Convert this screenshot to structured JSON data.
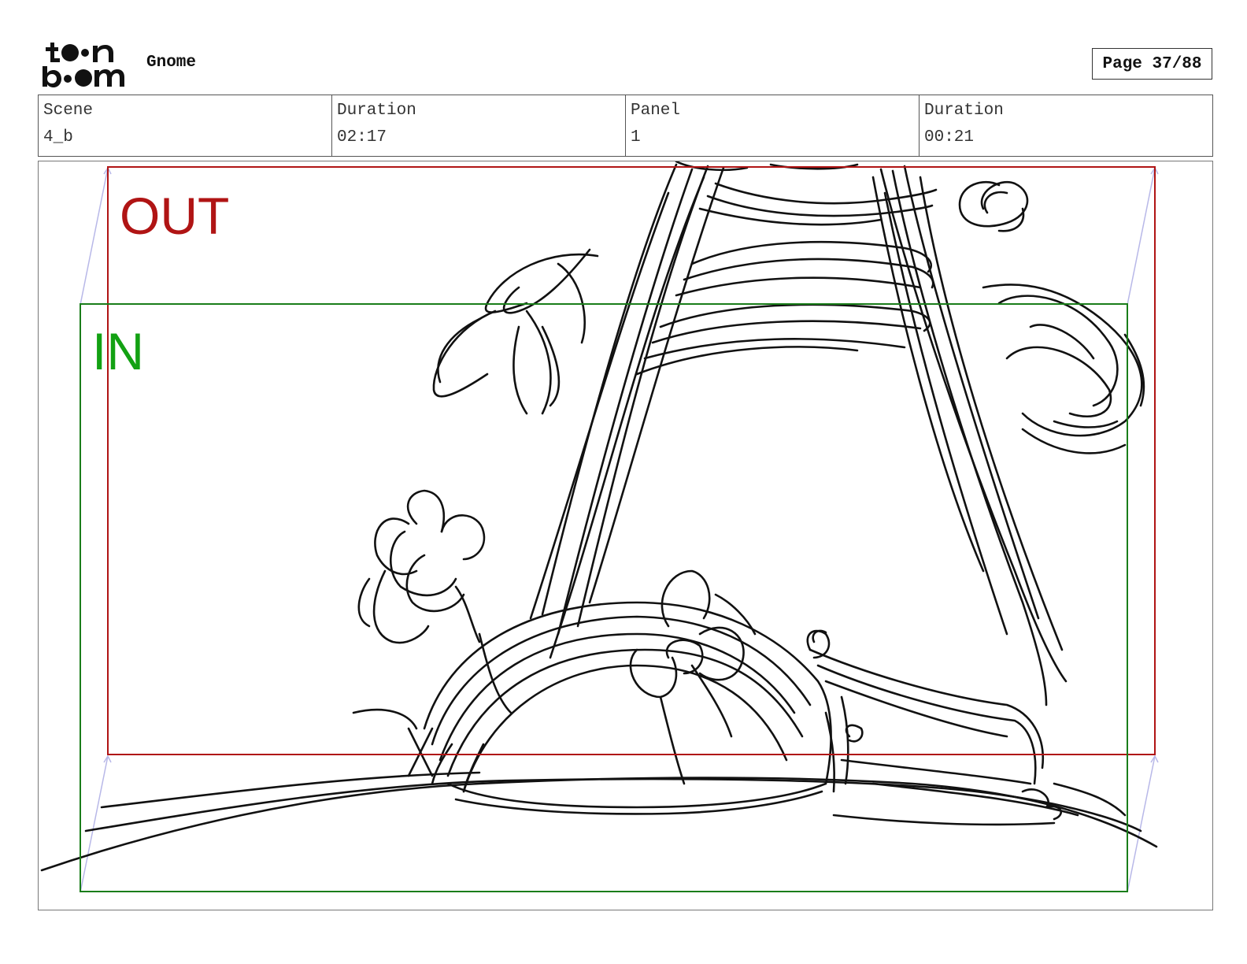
{
  "header": {
    "logo_text": "toon boom",
    "project_title": "Gnome",
    "page_label": "Page 37/88"
  },
  "info": {
    "scene_label": "Scene",
    "scene_value": "4_b",
    "scene_duration_label": "Duration",
    "scene_duration_value": "02:17",
    "panel_label": "Panel",
    "panel_value": "1",
    "panel_duration_label": "Duration",
    "panel_duration_value": "00:21"
  },
  "panel": {
    "out_label": "OUT",
    "in_label": "IN",
    "colors": {
      "out_frame": "#b01414",
      "in_frame": "#13a113",
      "camera_guides": "#b8b8e8",
      "sketch": "#111111"
    }
  }
}
